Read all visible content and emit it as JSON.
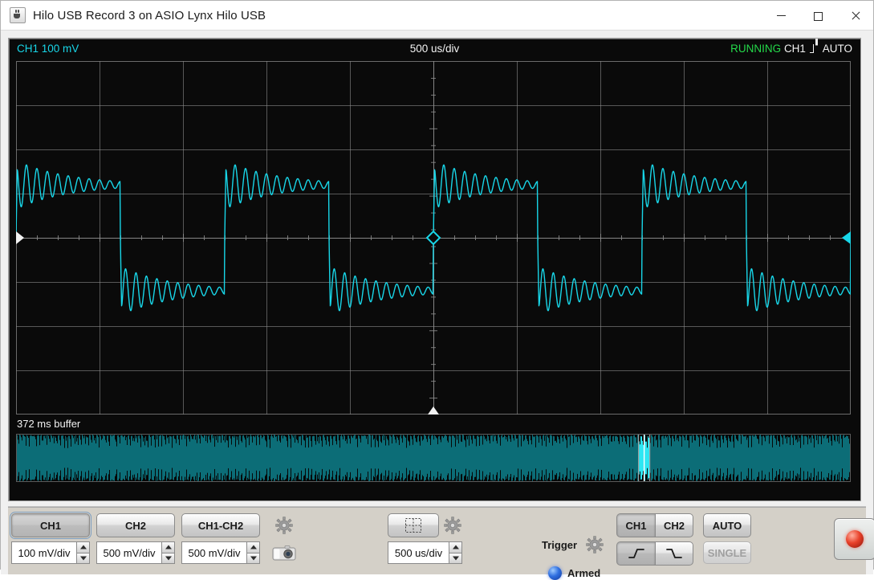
{
  "window": {
    "title": "Hilo USB Record 3 on ASIO Lynx Hilo USB",
    "app_icon": "java-coffee-cup-icon",
    "minimize_label": "—",
    "maximize_label": "□",
    "close_label": "✕"
  },
  "scope": {
    "ch1_readout": "CH1 100 mV",
    "timebase_readout": "500 us/div",
    "status_running": "RUNNING",
    "status_source": "CH1",
    "status_edge_icon": "rising-edge-icon",
    "status_mode": "AUTO",
    "buffer_label": "372 ms buffer",
    "colors": {
      "trace": "#18d6e8",
      "background": "#0a0a0a",
      "grid": "#8c8c8c",
      "running": "#24d94a",
      "buffer_trace": "#0c6d77",
      "buffer_selection": "#2ee6f2"
    },
    "grid": {
      "h_divisions": 10,
      "v_divisions": 8,
      "center_tick_count": 40
    },
    "markers": {
      "ground_left": "ground-marker-left",
      "ground_right": "ch1-ground-marker-right",
      "trigger_point": "trigger-point-diamond",
      "time_reference": "time-reference-marker"
    }
  },
  "chart_data": {
    "type": "line",
    "title": "CH1 100 mV",
    "xlabel": "500 us/div",
    "ylabel": "100 mV/div",
    "xlim": [
      -5,
      5
    ],
    "ylim": [
      -4,
      4
    ],
    "grid": true,
    "legend": null,
    "series": [
      {
        "name": "CH1",
        "color": "#18d6e8",
        "description": "Band-limited square wave with Gibbs ringing, period 2.5 divisions (1.25 ms), amplitude approx 2.5 divisions (250 mV) peak, ringing frequency approx 13 kHz decaying over each half cycle",
        "waveform": "square-with-ringing",
        "period_divisions": 2.5,
        "amplitude_divisions": 2.4,
        "ring_cycles_per_half": 10,
        "ring_decay": 0.82,
        "overshoot_divisions": 1.1,
        "phase_offset_divisions": 0.0
      }
    ]
  },
  "buffer_strip": {
    "selection_center_fraction": 0.753,
    "selection_width_fraction": 0.0135
  },
  "controls": {
    "source_buttons": [
      {
        "label": "CH1",
        "selected": true,
        "focused": true
      },
      {
        "label": "CH2",
        "selected": false,
        "focused": false
      },
      {
        "label": "CH1-CH2",
        "selected": false,
        "focused": false
      }
    ],
    "volts_spinners": [
      {
        "value": "100 mV/div"
      },
      {
        "value": "500 mV/div"
      },
      {
        "value": "500 mV/div"
      }
    ],
    "display_gear_icon": "gear-icon",
    "snapshot_icon": "camera-icon",
    "grid_toggle_icon": "grid-crosshair-icon",
    "timebase_gear_icon": "gear-icon",
    "timebase_spinner": {
      "value": "500 us/div"
    },
    "trigger_label": "Trigger",
    "trigger_gear_icon": "gear-icon",
    "armed_label": "Armed",
    "armed_led_color": "#2f6fe0",
    "trigger_source": [
      {
        "label": "CH1",
        "selected": true
      },
      {
        "label": "CH2",
        "selected": false
      }
    ],
    "trigger_slope": [
      {
        "icon": "rising-edge-icon",
        "selected": true
      },
      {
        "icon": "falling-edge-icon",
        "selected": false
      }
    ],
    "auto_button": {
      "label": "AUTO",
      "enabled": true
    },
    "single_button": {
      "label": "SINGLE",
      "enabled": false
    },
    "record_button": {
      "icon": "record-led-icon",
      "color": "#e8412a"
    }
  }
}
